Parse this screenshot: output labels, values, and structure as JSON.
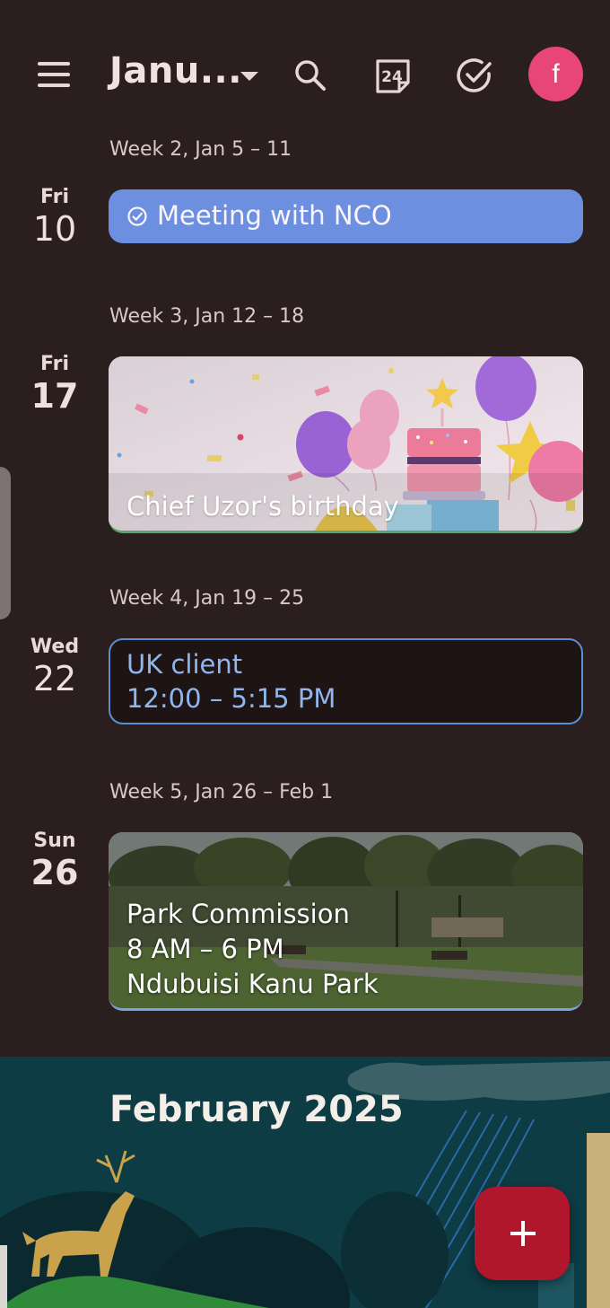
{
  "header": {
    "month_title": "Janu...",
    "today_date": "24",
    "avatar_letter": "f"
  },
  "weeks": [
    {
      "label": "Week 2, Jan 5 – 11"
    },
    {
      "label": "Week 3, Jan 12 – 18"
    },
    {
      "label": "Week 4, Jan 19 – 25"
    },
    {
      "label": "Week 5, Jan 26 – Feb 1"
    }
  ],
  "days": [
    {
      "name": "Fri",
      "num": "10"
    },
    {
      "name": "Fri",
      "num": "17"
    },
    {
      "name": "Wed",
      "num": "22"
    },
    {
      "name": "Sun",
      "num": "26"
    }
  ],
  "events": {
    "meeting": {
      "title": "Meeting with NCO",
      "color": "#6d8fdf"
    },
    "birthday": {
      "title": "Chief Uzor's birthday"
    },
    "uk_client": {
      "title": "UK client",
      "time": "12:00 – 5:15 PM",
      "color": "#8fb6ef"
    },
    "park": {
      "title": "Park Commission",
      "time": "8 AM – 6 PM",
      "location": "Ndubuisi Kanu Park"
    }
  },
  "february": {
    "title": "February 2025"
  },
  "colors": {
    "background": "#2b1e1e",
    "avatar": "#e8467a",
    "fab": "#b0162c",
    "banner": "#0d3c45"
  },
  "icons": {
    "menu": "hamburger-menu-icon",
    "search": "search-icon",
    "today": "calendar-today-icon",
    "tasks": "check-circle-icon",
    "add": "plus-icon"
  }
}
